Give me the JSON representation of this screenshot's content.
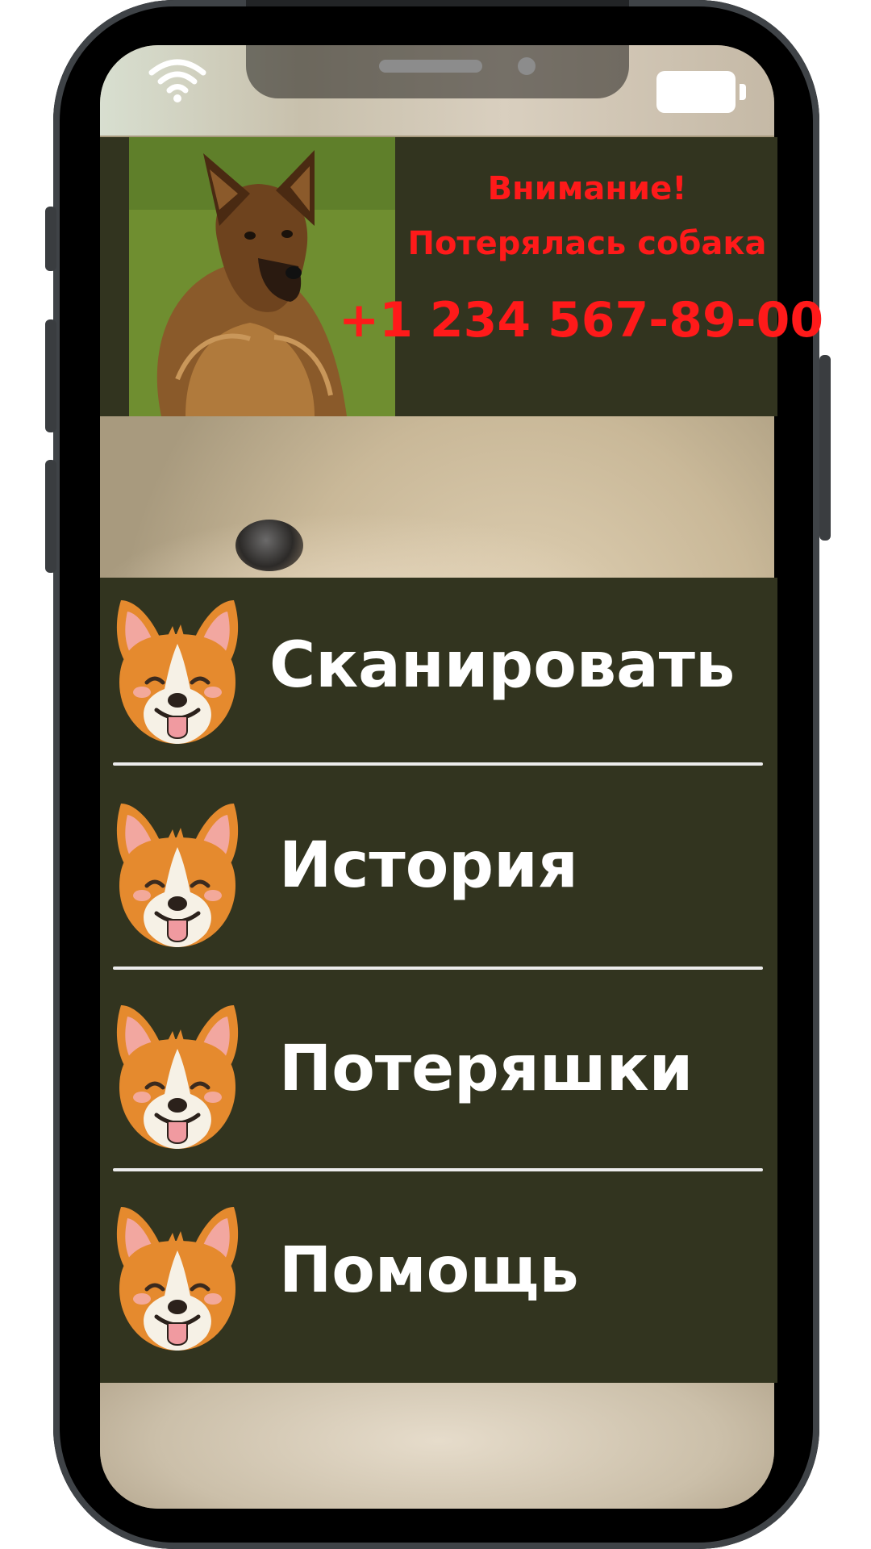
{
  "alert": {
    "line1": "Внимание!",
    "line2": "Потерялась собака",
    "phone": "+1 234 567-89-00",
    "text_color": "#ff1a1a",
    "background_color": "#32341f"
  },
  "menu": {
    "background_color": "#32341f",
    "items": [
      {
        "label": "Сканировать",
        "icon": "corgi-face-icon"
      },
      {
        "label": "История",
        "icon": "corgi-face-icon"
      },
      {
        "label": "Потеряшки",
        "icon": "corgi-face-icon"
      },
      {
        "label": "Помощь",
        "icon": "corgi-face-icon"
      }
    ]
  },
  "status_bar": {
    "icons": [
      "wifi-icon",
      "battery-icon"
    ]
  }
}
